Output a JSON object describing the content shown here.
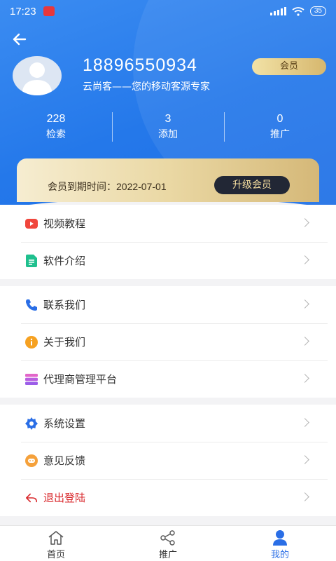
{
  "status_bar": {
    "time": "17:23",
    "battery": "35"
  },
  "profile": {
    "phone": "18896550934",
    "slogan": "云尚客——您的移动客源专家",
    "badge": "会员"
  },
  "stats": [
    {
      "value": "228",
      "label": "检索"
    },
    {
      "value": "3",
      "label": "添加"
    },
    {
      "value": "0",
      "label": "推广"
    }
  ],
  "vip": {
    "expire_label": "会员到期时间：",
    "expire_date": "2022-07-01",
    "upgrade_label": "升级会员"
  },
  "menu": {
    "video": "视频教程",
    "intro": "软件介绍",
    "contact": "联系我们",
    "about": "关于我们",
    "agent": "代理商管理平台",
    "settings": "系统设置",
    "feedback": "意见反馈",
    "logout": "退出登陆"
  },
  "tabs": [
    {
      "label": "首页",
      "icon": "home-icon"
    },
    {
      "label": "推广",
      "icon": "share-icon"
    },
    {
      "label": "我的",
      "icon": "user-icon"
    }
  ],
  "colors": {
    "primary": "#2478ea",
    "logout": "#d9282c",
    "gold": "#d6b76e"
  }
}
